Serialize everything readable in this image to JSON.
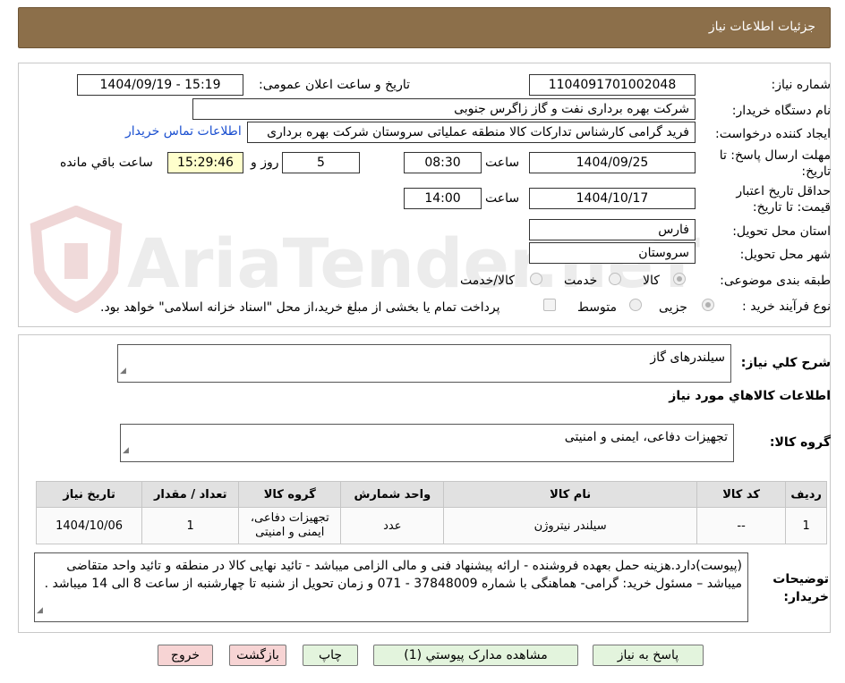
{
  "header": {
    "title": "جزئیات اطلاعات نیاز"
  },
  "watermark": "AriaTender.neT",
  "fields": {
    "need_number_label": "شماره نیاز:",
    "need_number": "1104091701002048",
    "announce_label": "تاریخ و ساعت اعلان عمومی:",
    "announce_value": "1404/09/19 - 15:19",
    "buyer_label": "نام دستگاه خریدار:",
    "buyer_value": "شرکت بهره برداری نفت و گاز زاگرس جنوبی",
    "requester_label": "ایجاد کننده درخواست:",
    "requester_value": "فرید گرامی کارشناس تدارکات کالا منطقه عملیاتی سروستان شرکت بهره برداری",
    "contact_link": "اطلاعات تماس خریدار",
    "deadline_label": "مهلت ارسال پاسخ: تا تاریخ:",
    "deadline_date": "1404/09/25",
    "time_label": "ساعت",
    "deadline_time": "08:30",
    "days_value": "5",
    "days_and_label": "روز و",
    "remaining_time": "15:29:46",
    "remaining_label": "ساعت باقي مانده",
    "validity_label": "حداقل تاریخ اعتبار قیمت: تا تاریخ:",
    "validity_date": "1404/10/17",
    "validity_time": "14:00",
    "province_label": "استان محل تحویل:",
    "province_value": "فارس",
    "city_label": "شهر محل تحویل:",
    "city_value": "سروستان",
    "category_label": "طبقه بندی موضوعی:",
    "category_options": [
      "کالا",
      "خدمت",
      "کالا/خدمت"
    ],
    "process_label": "نوع فرآیند خرید :",
    "process_options": [
      "جزیی",
      "متوسط"
    ],
    "process_note": "پرداخت تمام یا بخشی از مبلغ خرید،از محل \"اسناد خزانه اسلامی\" خواهد بود."
  },
  "summary": {
    "label": "شرح کلي نیاز:",
    "value": "سیلندرهای گاز",
    "goods_info_title": "اطلاعات کالاهاي مورد نياز",
    "group_label": "گروه کالا:",
    "group_value": "تجهیزات دفاعی، ایمنی و امنیتی"
  },
  "table": {
    "headers": [
      "ردیف",
      "کد کالا",
      "نام کالا",
      "واحد شمارش",
      "گروه کالا",
      "تعداد / مقدار",
      "تاریخ نیاز"
    ],
    "rows": [
      [
        "1",
        "--",
        "سیلندر نیتروژن",
        "عدد",
        "تجهیزات دفاعی، ایمنی و امنیتی",
        "1",
        "1404/10/06"
      ]
    ]
  },
  "notes": {
    "label": "توضیحات خریدار:",
    "value": "(پیوست)دارد.هزینه حمل بعهده فروشنده - ارائه پیشنهاد فنی و مالی الزامی میباشد - تائید نهایی کالا در منطقه و تائید واحد متقاضی میباشد – مسئول خرید: گرامی- هماهنگی با شماره 37848009 - 071 و زمان تحویل از شنبه تا چهارشنبه از ساعت 8 الی 14 میباشد ."
  },
  "buttons": {
    "reply": "پاسخ به نیاز",
    "attachments": "مشاهده مدارک پیوستي (1)",
    "print": "چاپ",
    "back": "بازگشت",
    "exit": "خروج"
  }
}
